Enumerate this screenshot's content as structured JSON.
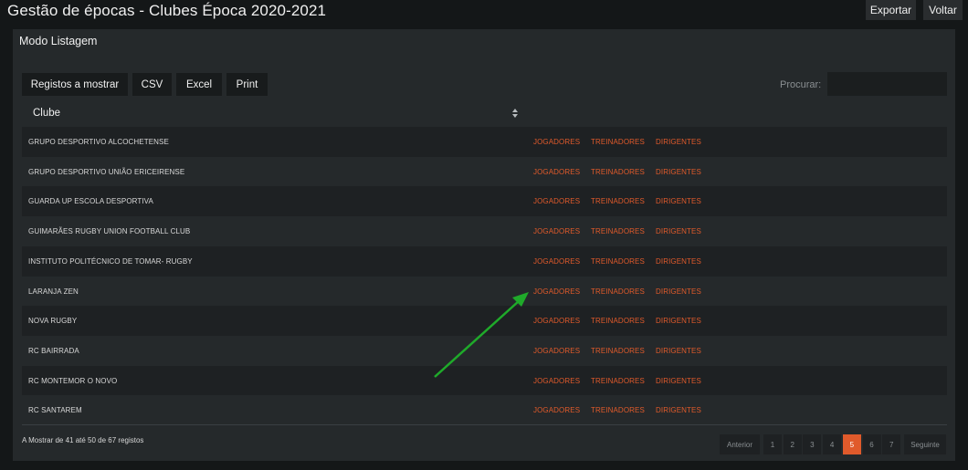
{
  "header": {
    "title": "Gestão de épocas - Clubes Época 2020-2021",
    "export_label": "Exportar",
    "back_label": "Voltar"
  },
  "panel": {
    "title": "Modo Listagem"
  },
  "toolbar": {
    "records_label": "Registos a mostrar",
    "csv_label": "CSV",
    "excel_label": "Excel",
    "print_label": "Print",
    "search_label": "Procurar:",
    "search_value": ""
  },
  "table": {
    "column_header": "Clube",
    "link_labels": [
      "JOGADORES",
      "TREINADORES",
      "DIRIGENTES"
    ],
    "rows": [
      {
        "name": "GRUPO DESPORTIVO ALCOCHETENSE"
      },
      {
        "name": "GRUPO DESPORTIVO UNIÃO ERICEIRENSE"
      },
      {
        "name": "GUARDA UP ESCOLA DESPORTIVA"
      },
      {
        "name": "GUIMARÃES RUGBY UNION FOOTBALL CLUB"
      },
      {
        "name": "INSTITUTO POLITÉCNICO DE TOMAR- RUGBY"
      },
      {
        "name": "LARANJA ZEN"
      },
      {
        "name": "NOVA RUGBY"
      },
      {
        "name": "RC BAIRRADA"
      },
      {
        "name": "RC MONTEMOR O NOVO"
      },
      {
        "name": "RC SANTAREM"
      }
    ]
  },
  "footer": {
    "info": "A Mostrar de 41 até 50 de 67 registos",
    "pagination": {
      "previous": "Anterior",
      "pages": [
        "1",
        "2",
        "3",
        "4",
        "5",
        "6",
        "7"
      ],
      "active_page": "5",
      "next": "Seguinte"
    }
  },
  "colors": {
    "accent": "#e05a2b",
    "arrow": "#1faa2a",
    "background": "#141718",
    "panel": "#25292b"
  }
}
